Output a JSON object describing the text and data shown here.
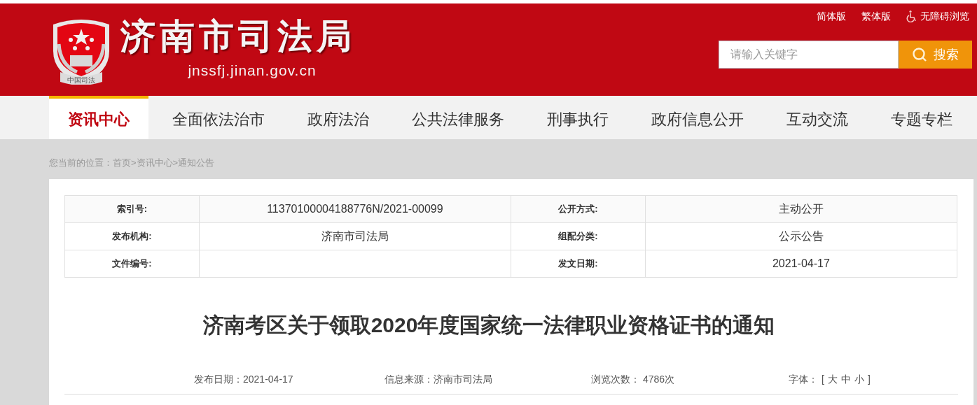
{
  "header": {
    "logo": {
      "emblem_text": "中国司法",
      "title": "济南市司法局",
      "domain": "jnssfj.jinan.gov.cn"
    },
    "top_links": [
      {
        "label": "简体版",
        "kind": "text"
      },
      {
        "label": "繁体版",
        "kind": "text"
      },
      {
        "label": "无障碍浏览",
        "kind": "accessibility"
      }
    ],
    "search": {
      "placeholder": "请输入关键字",
      "button": "搜索"
    }
  },
  "nav": [
    {
      "label": "资讯中心",
      "selected": true
    },
    {
      "label": "全面依法治市",
      "selected": false
    },
    {
      "label": "政府法治",
      "selected": false
    },
    {
      "label": "公共法律服务",
      "selected": false
    },
    {
      "label": "刑事执行",
      "selected": false
    },
    {
      "label": "政府信息公开",
      "selected": false
    },
    {
      "label": "互动交流",
      "selected": false
    },
    {
      "label": "专题专栏",
      "selected": false
    }
  ],
  "breadcrumb": "您当前的位置：首页>资讯中心>通知公告",
  "info_table": [
    [
      {
        "label": "索引号:",
        "value": "11370100004188776N/2021-00099"
      },
      {
        "label": "公开方式:",
        "value": "主动公开"
      }
    ],
    [
      {
        "label": "发布机构:",
        "value": "济南市司法局"
      },
      {
        "label": "组配分类:",
        "value": "公示公告"
      }
    ],
    [
      {
        "label": "文件编号:"
      },
      {
        "label": "发文日期:",
        "value": "2021-04-17"
      }
    ]
  ],
  "article": {
    "title": "济南考区关于领取2020年度国家统一法律职业资格证书的通知",
    "meta": [
      "发布日期：2021-04-17",
      "信息来源：济南市司法局",
      "浏览次数： 4786次"
    ],
    "font_size": {
      "label": "字体：",
      "open": "[",
      "options": [
        "大",
        "中",
        "小"
      ],
      "close": "]"
    }
  }
}
